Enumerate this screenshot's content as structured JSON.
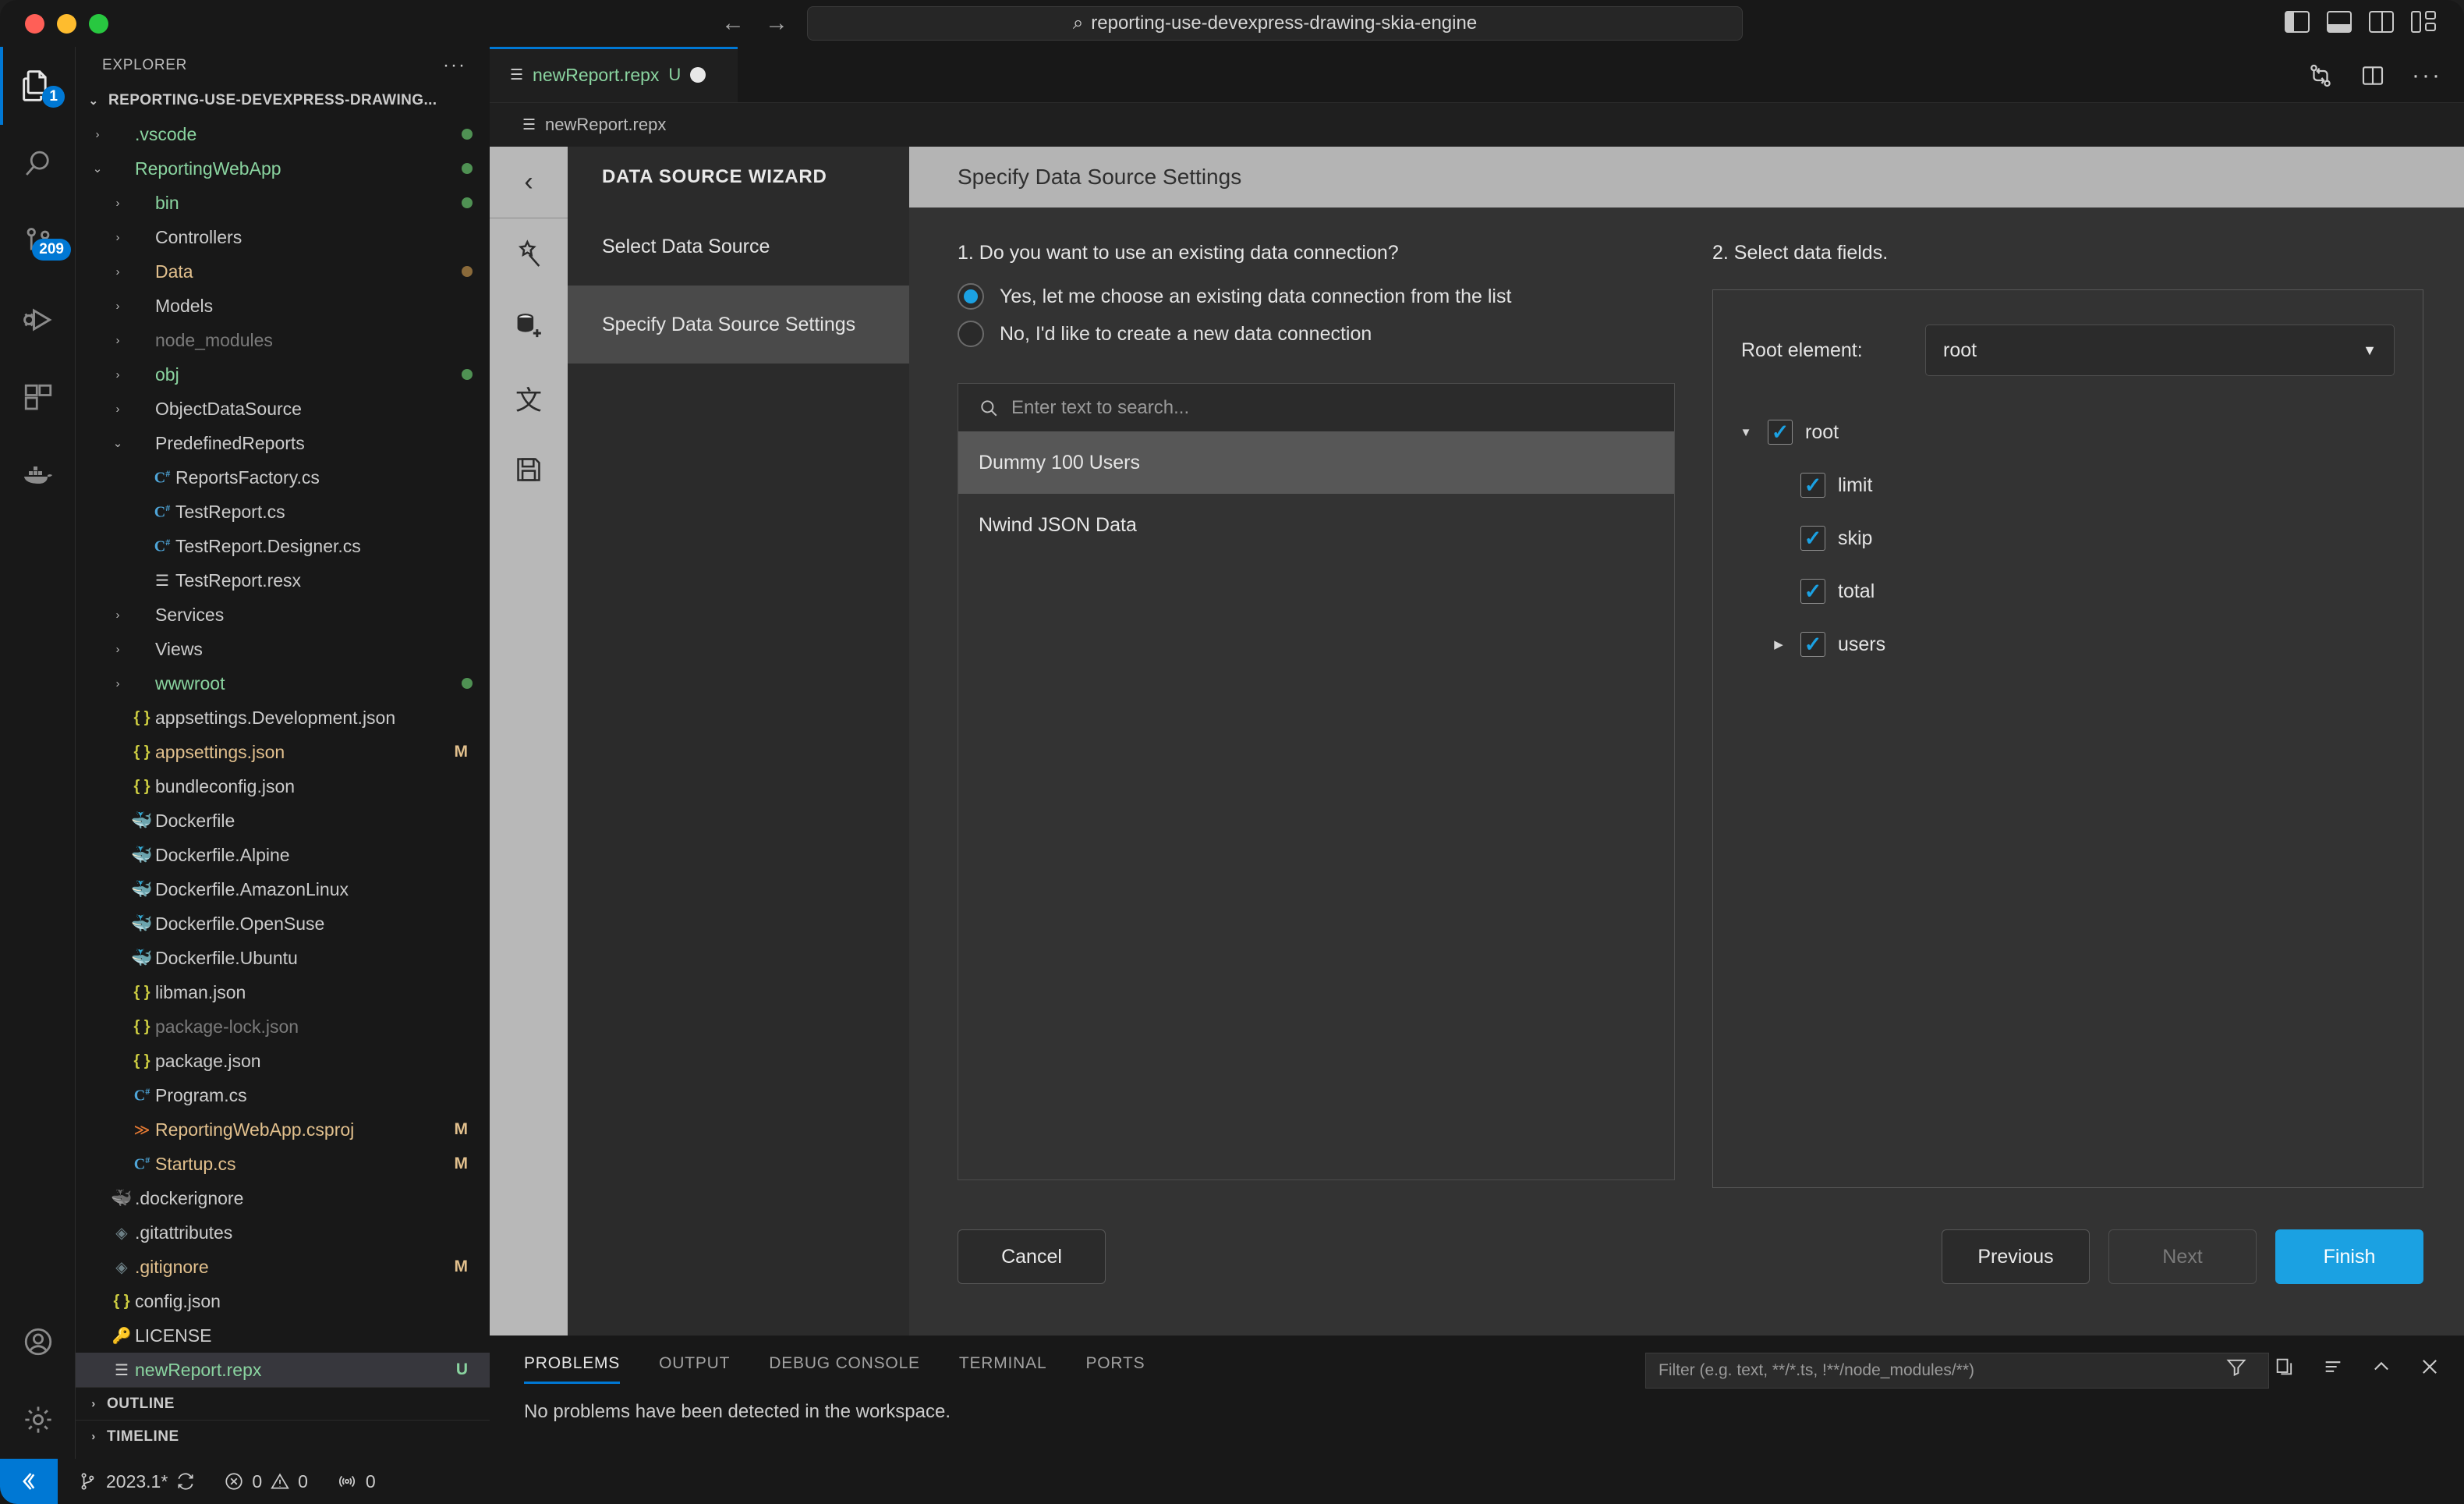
{
  "titlebar": {
    "search_value": "reporting-use-devexpress-drawing-skia-engine",
    "back_arrow": "←",
    "forward_arrow": "→",
    "search_icon": "⌕"
  },
  "activitybar": {
    "items": [
      {
        "name": "explorer",
        "badge": "1"
      },
      {
        "name": "search",
        "badge": ""
      },
      {
        "name": "source-control",
        "badge": "209"
      },
      {
        "name": "run-and-debug",
        "badge": ""
      },
      {
        "name": "extensions",
        "badge": ""
      },
      {
        "name": "docker",
        "badge": ""
      }
    ]
  },
  "sidebar": {
    "header": "EXPLORER",
    "header_actions": "···",
    "root_folder": "REPORTING-USE-DEVEXPRESS-DRAWING...",
    "items": [
      {
        "label": ".vscode",
        "indent": 1,
        "type": "folder",
        "expanded": false,
        "color": "green",
        "dot": "#4f9153",
        "status": ""
      },
      {
        "label": "ReportingWebApp",
        "indent": 1,
        "type": "folder",
        "expanded": true,
        "color": "green",
        "dot": "#4f9153",
        "status": ""
      },
      {
        "label": "bin",
        "indent": 2,
        "type": "folder",
        "expanded": false,
        "color": "green",
        "dot": "#4f9153",
        "status": ""
      },
      {
        "label": "Controllers",
        "indent": 2,
        "type": "folder",
        "expanded": false,
        "color": "plain",
        "dot": "",
        "status": ""
      },
      {
        "label": "Data",
        "indent": 2,
        "type": "folder",
        "expanded": false,
        "color": "amber",
        "dot": "#8a6a3a",
        "status": ""
      },
      {
        "label": "Models",
        "indent": 2,
        "type": "folder",
        "expanded": false,
        "color": "plain",
        "dot": "",
        "status": ""
      },
      {
        "label": "node_modules",
        "indent": 2,
        "type": "folder",
        "expanded": false,
        "color": "dim",
        "dot": "",
        "status": ""
      },
      {
        "label": "obj",
        "indent": 2,
        "type": "folder",
        "expanded": false,
        "color": "green",
        "dot": "#4f9153",
        "status": ""
      },
      {
        "label": "ObjectDataSource",
        "indent": 2,
        "type": "folder",
        "expanded": false,
        "color": "plain",
        "dot": "",
        "status": ""
      },
      {
        "label": "PredefinedReports",
        "indent": 2,
        "type": "folder",
        "expanded": true,
        "color": "plain",
        "dot": "",
        "status": ""
      },
      {
        "label": "ReportsFactory.cs",
        "indent": 3,
        "type": "cs",
        "color": "plain",
        "dot": "",
        "status": ""
      },
      {
        "label": "TestReport.cs",
        "indent": 3,
        "type": "cs",
        "color": "plain",
        "dot": "",
        "status": ""
      },
      {
        "label": "TestReport.Designer.cs",
        "indent": 3,
        "type": "cs",
        "color": "plain",
        "dot": "",
        "status": ""
      },
      {
        "label": "TestReport.resx",
        "indent": 3,
        "type": "xml",
        "color": "plain",
        "dot": "",
        "status": ""
      },
      {
        "label": "Services",
        "indent": 2,
        "type": "folder",
        "expanded": false,
        "color": "plain",
        "dot": "",
        "status": ""
      },
      {
        "label": "Views",
        "indent": 2,
        "type": "folder",
        "expanded": false,
        "color": "plain",
        "dot": "",
        "status": ""
      },
      {
        "label": "wwwroot",
        "indent": 2,
        "type": "folder",
        "expanded": false,
        "color": "green",
        "dot": "#4f9153",
        "status": ""
      },
      {
        "label": "appsettings.Development.json",
        "indent": 2,
        "type": "json",
        "color": "plain",
        "dot": "",
        "status": ""
      },
      {
        "label": "appsettings.json",
        "indent": 2,
        "type": "json",
        "color": "amber",
        "dot": "",
        "status": "M"
      },
      {
        "label": "bundleconfig.json",
        "indent": 2,
        "type": "json",
        "color": "plain",
        "dot": "",
        "status": ""
      },
      {
        "label": "Dockerfile",
        "indent": 2,
        "type": "docker",
        "color": "plain",
        "dot": "",
        "status": ""
      },
      {
        "label": "Dockerfile.Alpine",
        "indent": 2,
        "type": "docker",
        "color": "plain",
        "dot": "",
        "status": ""
      },
      {
        "label": "Dockerfile.AmazonLinux",
        "indent": 2,
        "type": "docker",
        "color": "plain",
        "dot": "",
        "status": ""
      },
      {
        "label": "Dockerfile.OpenSuse",
        "indent": 2,
        "type": "docker",
        "color": "plain",
        "dot": "",
        "status": ""
      },
      {
        "label": "Dockerfile.Ubuntu",
        "indent": 2,
        "type": "docker",
        "color": "plain",
        "dot": "",
        "status": ""
      },
      {
        "label": "libman.json",
        "indent": 2,
        "type": "json",
        "color": "plain",
        "dot": "",
        "status": ""
      },
      {
        "label": "package-lock.json",
        "indent": 2,
        "type": "json",
        "color": "dim",
        "dot": "",
        "status": ""
      },
      {
        "label": "package.json",
        "indent": 2,
        "type": "json",
        "color": "plain",
        "dot": "",
        "status": ""
      },
      {
        "label": "Program.cs",
        "indent": 2,
        "type": "cs",
        "color": "plain",
        "dot": "",
        "status": ""
      },
      {
        "label": "ReportingWebApp.csproj",
        "indent": 2,
        "type": "proj",
        "color": "amber",
        "dot": "",
        "status": "M"
      },
      {
        "label": "Startup.cs",
        "indent": 2,
        "type": "cs",
        "color": "amber",
        "dot": "",
        "status": "M"
      },
      {
        "label": ".dockerignore",
        "indent": 1,
        "type": "docker-dim",
        "color": "plain",
        "dot": "",
        "status": ""
      },
      {
        "label": ".gitattributes",
        "indent": 1,
        "type": "git",
        "color": "plain",
        "dot": "",
        "status": ""
      },
      {
        "label": ".gitignore",
        "indent": 1,
        "type": "git",
        "color": "amber",
        "dot": "",
        "status": "M"
      },
      {
        "label": "config.json",
        "indent": 1,
        "type": "json",
        "color": "plain",
        "dot": "",
        "status": ""
      },
      {
        "label": "LICENSE",
        "indent": 1,
        "type": "key",
        "color": "plain",
        "dot": "",
        "status": ""
      },
      {
        "label": "newReport.repx",
        "indent": 1,
        "type": "xml",
        "color": "green",
        "dot": "",
        "status": "U",
        "selected": true
      }
    ],
    "outline": "OUTLINE",
    "timeline": "TIMELINE"
  },
  "editor": {
    "tab": {
      "label": "newReport.repx",
      "state": "U",
      "dirty": true
    },
    "breadcrumb": "newReport.repx",
    "actions": [
      "compare-icon",
      "split-editor-icon",
      "more-actions-icon"
    ]
  },
  "wizard": {
    "icons": [
      "back-chevron-icon",
      "magic-wand-icon",
      "add-data-source-icon",
      "localization-icon",
      "save-icon"
    ],
    "nav_title": "DATA SOURCE WIZARD",
    "steps": [
      {
        "label": "Select Data Source",
        "active": false
      },
      {
        "label": "Specify Data Source Settings",
        "active": true
      }
    ],
    "header_title": "Specify Data Source Settings",
    "question1": "1. Do you want to use an existing data connection?",
    "radios": [
      {
        "label": "Yes, let me choose an existing data connection from the list",
        "checked": true
      },
      {
        "label": "No, I'd like to create a new data connection",
        "checked": false
      }
    ],
    "search_placeholder": "Enter text to search...",
    "connections": [
      {
        "label": "Dummy 100 Users",
        "selected": true
      },
      {
        "label": "Nwind JSON Data",
        "selected": false
      }
    ],
    "question2": "2. Select data fields.",
    "root_element_label": "Root element:",
    "root_element_value": "root",
    "fields": [
      {
        "label": "root",
        "level": 0,
        "checked": true,
        "arrow": "down"
      },
      {
        "label": "limit",
        "level": 1,
        "checked": true,
        "arrow": "none"
      },
      {
        "label": "skip",
        "level": 1,
        "checked": true,
        "arrow": "none"
      },
      {
        "label": "total",
        "level": 1,
        "checked": true,
        "arrow": "none"
      },
      {
        "label": "users",
        "level": 1,
        "checked": true,
        "arrow": "right"
      }
    ],
    "buttons": {
      "cancel": "Cancel",
      "previous": "Previous",
      "next": "Next",
      "finish": "Finish"
    },
    "accent_color": "#1ba1e2"
  },
  "panel": {
    "tabs": [
      {
        "label": "PROBLEMS",
        "active": true
      },
      {
        "label": "OUTPUT",
        "active": false
      },
      {
        "label": "DEBUG CONSOLE",
        "active": false
      },
      {
        "label": "TERMINAL",
        "active": false
      },
      {
        "label": "PORTS",
        "active": false
      }
    ],
    "message": "No problems have been detected in the workspace.",
    "filter_placeholder": "Filter (e.g. text, **/*.ts, !**/node_modules/**)",
    "actions": [
      "filter-icon",
      "collapse-icon",
      "list-icon",
      "chevron-up-icon",
      "close-icon"
    ]
  },
  "statusbar": {
    "remote_icon": "remote-window-icon",
    "branch": "2023.1*",
    "sync_icon": "sync-icon",
    "errors": "0",
    "warnings": "0",
    "ports": "0"
  }
}
